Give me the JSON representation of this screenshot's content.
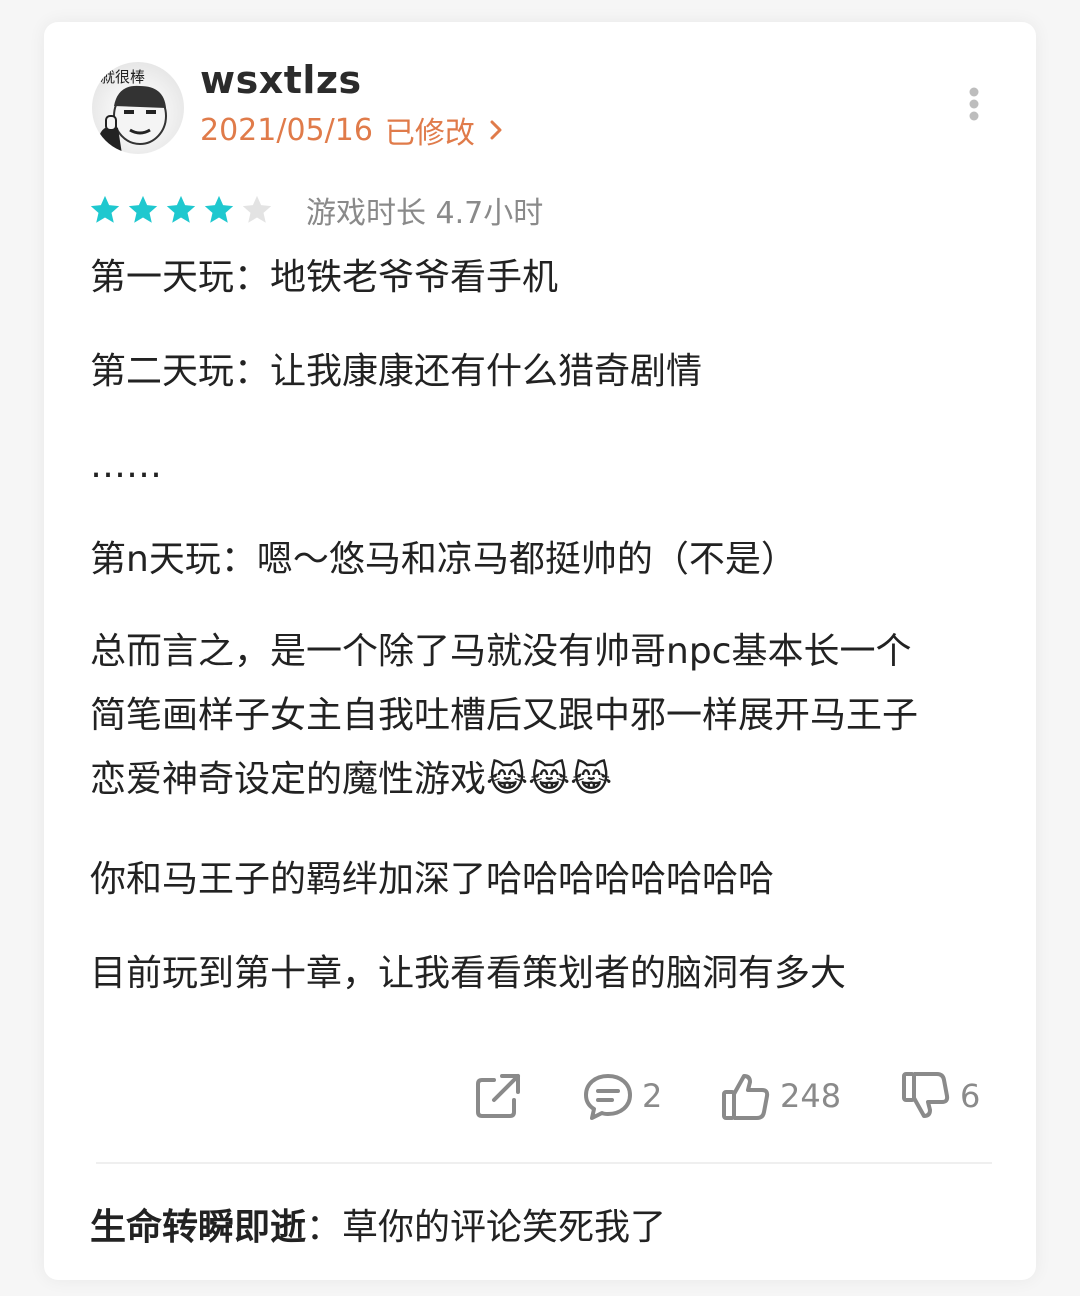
{
  "author": {
    "avatar_caption": "就很棒",
    "username": "wsxtlzs",
    "date": "2021/05/16",
    "edited_label": "已修改"
  },
  "rating": {
    "stars_filled": 4,
    "stars_total": 5,
    "star_color": "#1fc8cf",
    "playtime": "游戏时长 4.7小时"
  },
  "review": {
    "lines": [
      "第一天玩：地铁老爷爷看手机",
      "第二天玩：让我康康还有什么猎奇剧情",
      "……",
      "第n天玩：嗯～悠马和凉马都挺帅的（不是）",
      "总而言之，是一个除了马就没有帅哥npc基本长一个\n简笔画样子女主自我吐槽后又跟中邪一样展开马王子\n恋爱神奇设定的魔性游戏😹😹😹",
      "你和马王子的羁绊加深了哈哈哈哈哈哈哈哈",
      "目前玩到第十章，让我看看策划者的脑洞有多大"
    ]
  },
  "actions": {
    "comment_count": "2",
    "like_count": "248",
    "dislike_count": "6"
  },
  "reply": {
    "author": "生命转瞬即逝",
    "separator": "：",
    "text": "草你的评论笑死我了"
  },
  "colors": {
    "accent_date": "#e07b4a",
    "text_primary": "#222222",
    "text_secondary": "#8a8a8a"
  }
}
